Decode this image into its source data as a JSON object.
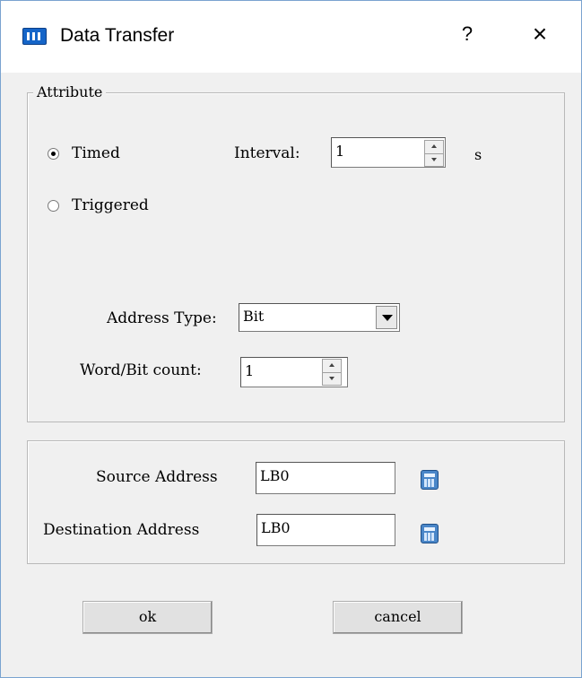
{
  "window": {
    "title": "Data Transfer",
    "help_label": "?",
    "close_label": "×",
    "accent": "#1565c8"
  },
  "attribute": {
    "legend": "Attribute",
    "timed_label": "Timed",
    "triggered_label": "Triggered",
    "selected": "Timed",
    "interval_label": "Interval:",
    "interval_value": "1",
    "interval_unit": "s",
    "address_type_label": "Address Type:",
    "address_type_value": "Bit",
    "count_label": "Word/Bit count:",
    "count_value": "1"
  },
  "addresses": {
    "source_label": "Source Address",
    "source_value": "LB0",
    "destination_label": "Destination Address",
    "destination_value": "LB0",
    "picker_icon": "calculator-icon"
  },
  "buttons": {
    "ok": "ok",
    "cancel": "cancel"
  }
}
